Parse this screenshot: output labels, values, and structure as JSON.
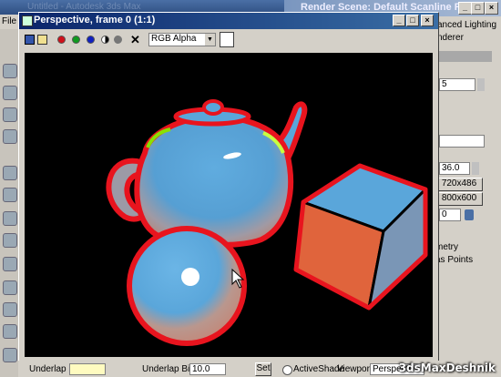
{
  "app": {
    "menu_label": "File",
    "faded_title": "Untitled - Autodesk 3ds Max"
  },
  "render_scene": {
    "title": "Render Scene: Default Scanline Rende...",
    "tab_right": "anced Lighting",
    "tab_right2": "nderer",
    "spinner_value": "5",
    "aperture_value": "36.0",
    "preset_buttons": [
      "720x486",
      "800x600"
    ],
    "spinner2_value": "0",
    "list_text_1": "metry",
    "list_text_2": "as Points",
    "close_glyph": "×",
    "min_glyph": "_",
    "max_glyph": "□"
  },
  "frame_window": {
    "title": "Perspective, frame 0 (1:1)",
    "channel_select": "RGB Alpha",
    "clear_glyph": "✕"
  },
  "bottom_bar": {
    "underlap_label": "Underlap",
    "underlap_bias_label": "Underlap Bias:",
    "underlap_bias_value": "10.0",
    "set_label": "Set",
    "activeshade_label": "ActiveShade",
    "viewport_label": "Viewport",
    "viewport_value": "Perspective"
  },
  "watermark": "3dsMaxDeshnik",
  "colors": {
    "outline": "#e8141e",
    "blue": "#4f9fd6",
    "cube_front": "#e0643c",
    "edge_glow": "#8be000"
  }
}
